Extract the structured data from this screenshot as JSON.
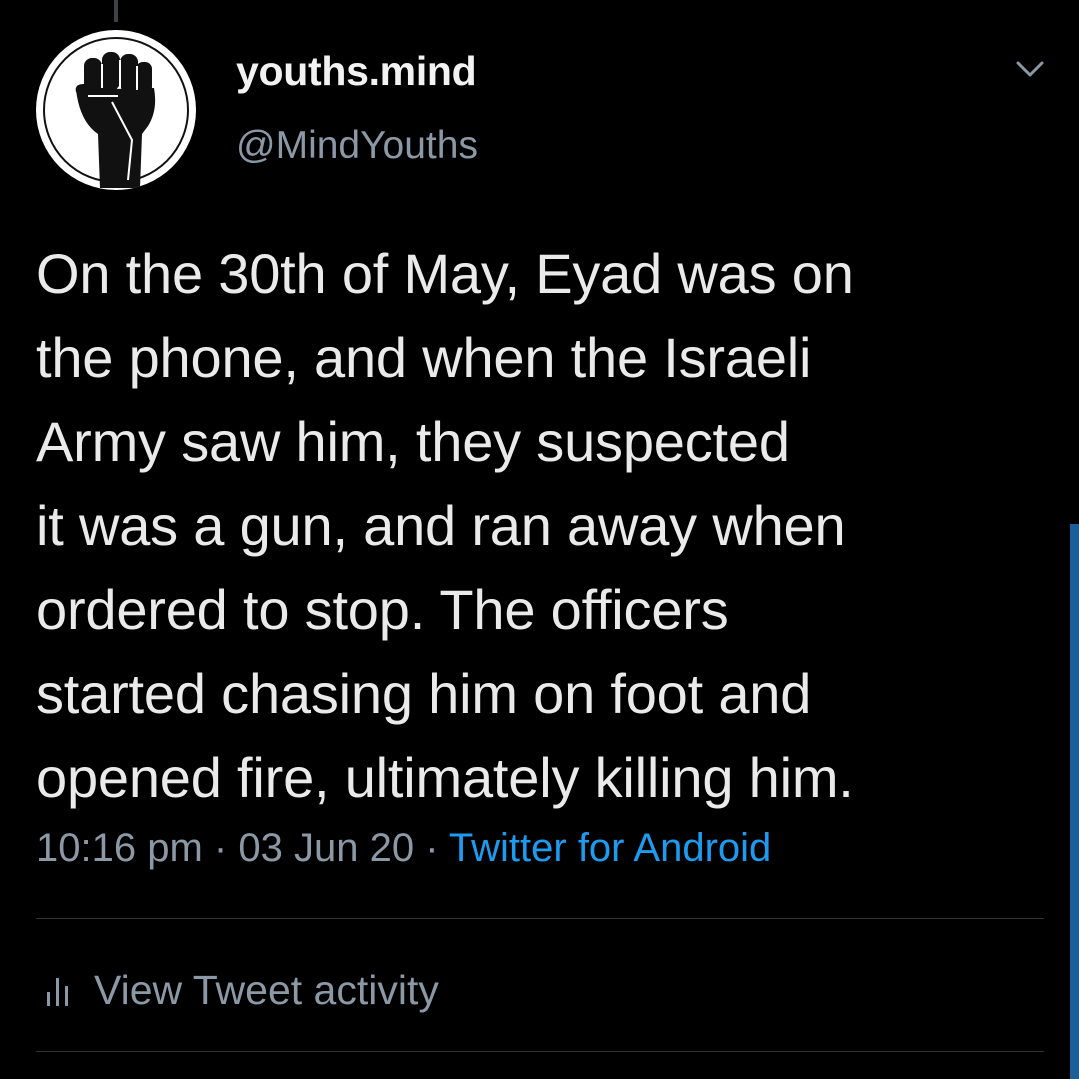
{
  "tweet": {
    "display_name": "youths.mind",
    "handle": "@MindYouths",
    "text": "On the 30th of May, Eyad was on\nthe phone, and when the Israeli\nArmy saw him, they suspected\nit was a gun, and ran away when\nordered to stop. The officers\nstarted chasing him on foot and\nopened fire, ultimately killing him.",
    "time": "10:16 pm",
    "date": "03 Jun 20",
    "separator": "·",
    "source": "Twitter for Android"
  },
  "actions": {
    "view_activity_label": "View Tweet activity"
  },
  "icons": {
    "avatar": "raised-fist-icon",
    "menu": "chevron-down-icon",
    "activity": "bar-chart-icon"
  },
  "colors": {
    "background": "#000000",
    "text": "#e7e9ea",
    "muted": "#8b98a5",
    "accent": "#1d9bf0",
    "divider": "#2f3336"
  }
}
